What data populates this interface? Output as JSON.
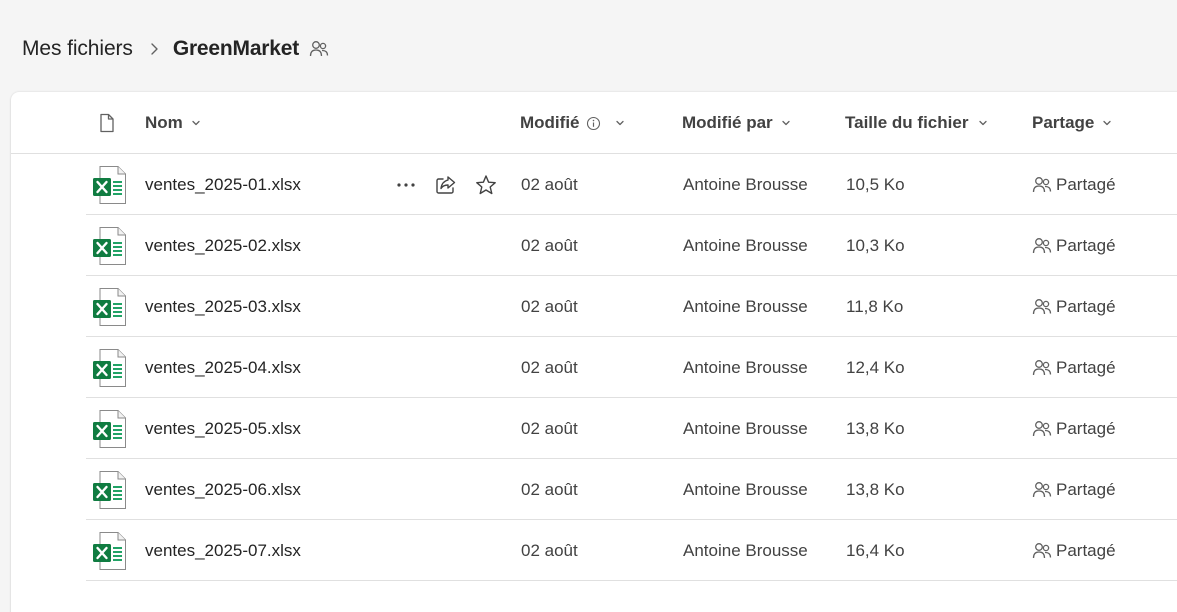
{
  "breadcrumb": {
    "root": "Mes fichiers",
    "current": "GreenMarket"
  },
  "columns": {
    "name": "Nom",
    "modified": "Modifié",
    "modified_by": "Modifié par",
    "size": "Taille du fichier",
    "sharing": "Partage"
  },
  "icons": {
    "breadcrumb_separator": "chevron-right-icon",
    "shared_folder": "people-icon",
    "file_type_header": "document-icon",
    "sort": "chevron-down-icon",
    "modified_info": "info-icon",
    "file": "excel-file-icon",
    "more": "more-horizontal-icon",
    "share": "share-icon",
    "favorite": "star-icon",
    "shared": "people-icon"
  },
  "colors": {
    "excel_green": "#107c41",
    "excel_green_light": "#21a366",
    "text_primary": "#242424",
    "text_secondary": "#424242",
    "divider": "#e0e0e0",
    "page_bg": "#f5f5f5"
  },
  "files": [
    {
      "name": "ventes_2025-01.xlsx",
      "modified": "02 août",
      "modified_by": "Antoine Brousse",
      "size": "10,5 Ko",
      "sharing": "Partagé"
    },
    {
      "name": "ventes_2025-02.xlsx",
      "modified": "02 août",
      "modified_by": "Antoine Brousse",
      "size": "10,3 Ko",
      "sharing": "Partagé"
    },
    {
      "name": "ventes_2025-03.xlsx",
      "modified": "02 août",
      "modified_by": "Antoine Brousse",
      "size": "11,8 Ko",
      "sharing": "Partagé"
    },
    {
      "name": "ventes_2025-04.xlsx",
      "modified": "02 août",
      "modified_by": "Antoine Brousse",
      "size": "12,4 Ko",
      "sharing": "Partagé"
    },
    {
      "name": "ventes_2025-05.xlsx",
      "modified": "02 août",
      "modified_by": "Antoine Brousse",
      "size": "13,8 Ko",
      "sharing": "Partagé"
    },
    {
      "name": "ventes_2025-06.xlsx",
      "modified": "02 août",
      "modified_by": "Antoine Brousse",
      "size": "13,8 Ko",
      "sharing": "Partagé"
    },
    {
      "name": "ventes_2025-07.xlsx",
      "modified": "02 août",
      "modified_by": "Antoine Brousse",
      "size": "16,4 Ko",
      "sharing": "Partagé"
    }
  ]
}
